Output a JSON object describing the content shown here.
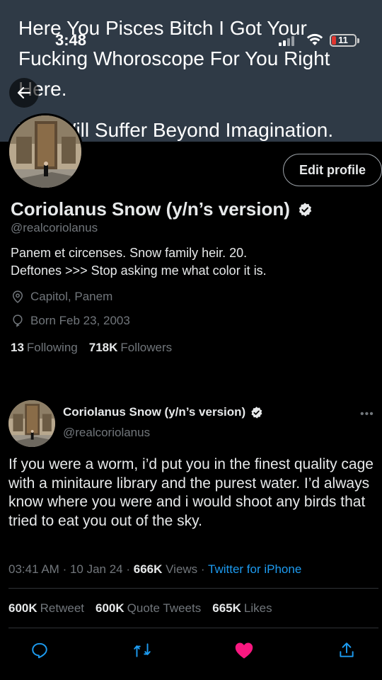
{
  "banner": {
    "lines": [
      "Here You Pisces Bitch I Got Your Fucking Whoroscope For You Right Here.",
      "You Will Suffer Beyond Imagination."
    ]
  },
  "status_bar": {
    "time": "3:48",
    "battery": "11"
  },
  "profile": {
    "edit_label": "Edit profile",
    "name": "Coriolanus Snow (y/n’s version)",
    "handle": "@realcoriolanus",
    "bio_line1": "Panem et circenses. Snow family heir. 20.",
    "bio_line2": "Deftones >>> Stop asking me what color it is.",
    "location": "Capitol, Panem",
    "born": "Born Feb 23, 2003",
    "following_count": "13",
    "following_label": "Following",
    "followers_count": "718K",
    "followers_label": "Followers"
  },
  "tweet": {
    "author_name": "Coriolanus Snow (y/n’s version)",
    "author_handle": "@realcoriolanus",
    "more": "•••",
    "text": "If you were a worm, i’d put you in the finest quality cage with a minitaure library and the purest water. I’d always know where you were and i would shoot any birds that tried to eat you out of the sky.",
    "time": "03:41 AM",
    "date": "10 Jan 24",
    "views_count": "666K",
    "views_label": "Views",
    "source": "Twitter for iPhone",
    "retweet_count": "600K",
    "retweet_label": "Retweet",
    "quote_count": "600K",
    "quote_label": "Quote Tweets",
    "likes_count": "665K",
    "likes_label": "Likes"
  },
  "colors": {
    "accent": "#1d9bf0",
    "like": "#f91880",
    "muted": "#71767b",
    "banner": "#2f3a46"
  },
  "icons": [
    "back-arrow-icon",
    "verified-badge-icon",
    "location-pin-icon",
    "birthday-balloon-icon",
    "more-dots-icon",
    "reply-icon",
    "retweet-icon",
    "like-heart-icon",
    "share-icon"
  ]
}
